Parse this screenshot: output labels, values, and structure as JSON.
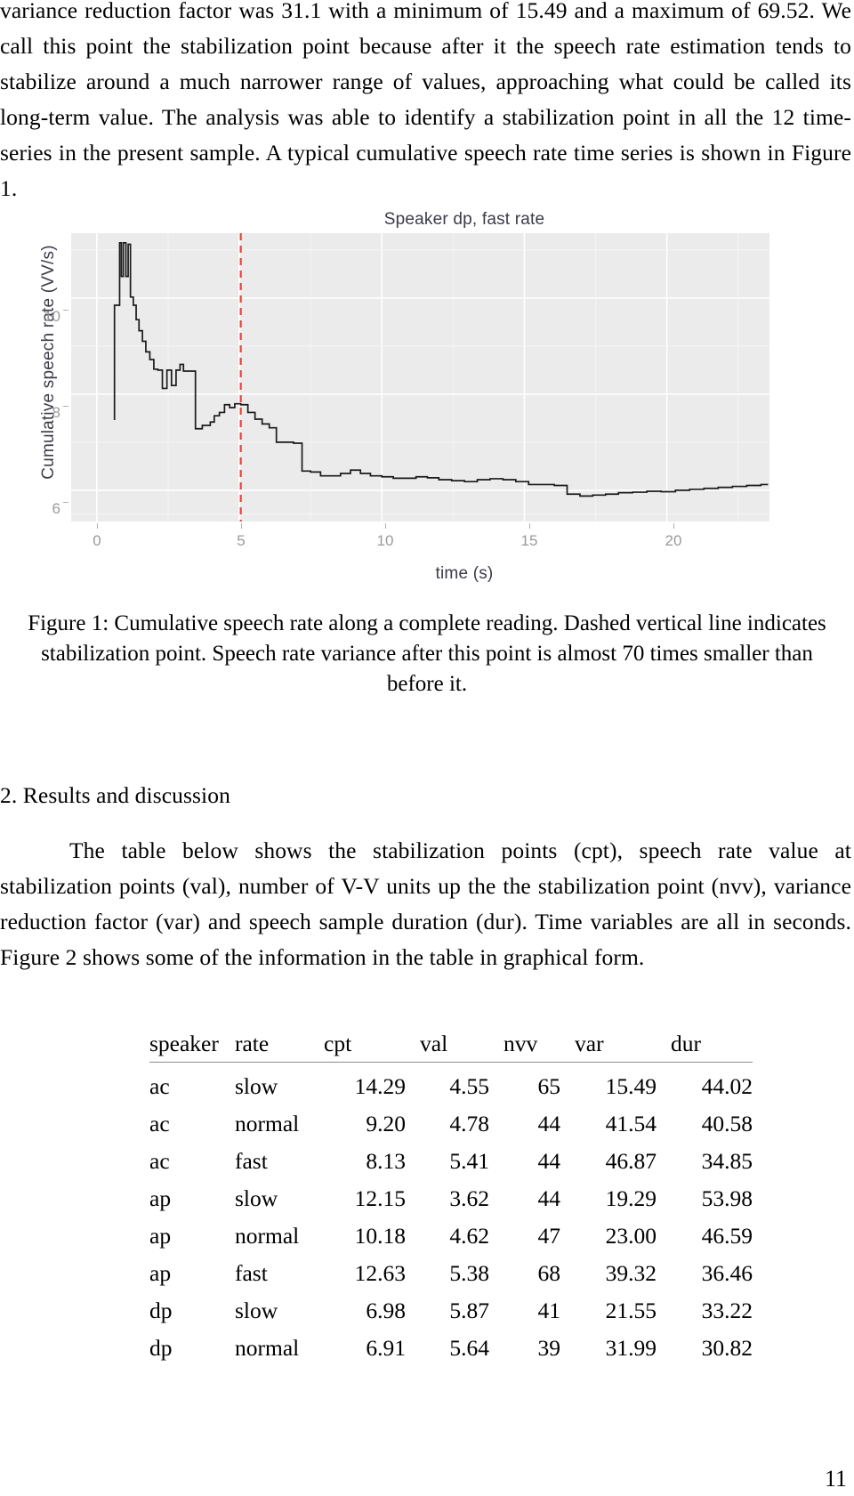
{
  "document": {
    "page_number": "11",
    "paragraph_top": "variance reduction factor was 31.1 with a minimum of 15.49 and a maximum of 69.52. We call this point the stabilization point because after it the speech rate estimation tends to stabilize around a much narrower range of values, approaching what could be called its long-term value. The analysis was able to identify a stabilization point in all the 12 time-series in the present sample. A typical cumulative speech rate time series is shown in Figure 1.",
    "figure_caption": "Figure 1: Cumulative speech rate along a complete reading. Dashed vertical line indicates stabilization point. Speech rate variance after this point is almost 70 times smaller than before it.",
    "section_heading": "2. Results and discussion",
    "paragraph_results": "The table below shows the stabilization points (cpt), speech rate value at stabilization points (val), number of V-V units up the the stabilization point (nvv), variance reduction factor (var) and speech sample duration (dur). Time variables are all in seconds. Figure 2 shows some of the information in the table in graphical form."
  },
  "table": {
    "headers": [
      "speaker",
      "rate",
      "cpt",
      "val",
      "nvv",
      "var",
      "dur"
    ],
    "rows": [
      [
        "ac",
        "slow",
        "14.29",
        "4.55",
        "65",
        "15.49",
        "44.02"
      ],
      [
        "ac",
        "normal",
        "9.20",
        "4.78",
        "44",
        "41.54",
        "40.58"
      ],
      [
        "ac",
        "fast",
        "8.13",
        "5.41",
        "44",
        "46.87",
        "34.85"
      ],
      [
        "ap",
        "slow",
        "12.15",
        "3.62",
        "44",
        "19.29",
        "53.98"
      ],
      [
        "ap",
        "normal",
        "10.18",
        "4.62",
        "47",
        "23.00",
        "46.59"
      ],
      [
        "ap",
        "fast",
        "12.63",
        "5.38",
        "68",
        "39.32",
        "36.46"
      ],
      [
        "dp",
        "slow",
        "6.98",
        "5.87",
        "41",
        "21.55",
        "33.22"
      ],
      [
        "dp",
        "normal",
        "6.91",
        "5.64",
        "39",
        "31.99",
        "30.82"
      ]
    ]
  },
  "chart_data": {
    "type": "line",
    "title": "Speaker dp, fast rate",
    "xlabel": "time (s)",
    "ylabel": "Cumulative speech rate (VV/s)",
    "xticks": [
      "0",
      "5",
      "10",
      "15",
      "20"
    ],
    "yticks": [
      "6",
      "8",
      "10"
    ],
    "xlim": [
      -0.9,
      23.6
    ],
    "ylim": [
      5.35,
      11.35
    ],
    "grid": true,
    "panel_bg": "#ebebeb",
    "grid_color": "#ffffff",
    "line_color": "#1a1a1a",
    "annotation": {
      "type": "vline",
      "label": "stabilization point",
      "x": 5.05,
      "color": "#e8443a",
      "style": "dashed"
    },
    "series": [
      {
        "name": "Cumulative speech rate",
        "step": "hv",
        "x": [
          0.62,
          0.62,
          0.8,
          0.86,
          0.93,
          1.02,
          1.1,
          1.18,
          1.28,
          1.38,
          1.48,
          1.6,
          1.72,
          1.86,
          2.0,
          2.14,
          2.3,
          2.46,
          2.62,
          2.78,
          2.92,
          3.04,
          3.14,
          3.24,
          3.34,
          3.46,
          3.58,
          3.7,
          3.84,
          3.98,
          4.12,
          4.3,
          4.48,
          4.66,
          4.84,
          5.05,
          5.3,
          5.55,
          5.8,
          6.05,
          6.3,
          6.6,
          6.9,
          7.2,
          7.5,
          7.85,
          8.2,
          8.55,
          8.9,
          9.25,
          9.6,
          10.0,
          10.4,
          10.8,
          11.2,
          11.6,
          12.0,
          12.45,
          12.9,
          13.35,
          13.8,
          14.25,
          14.7,
          15.15,
          15.6,
          16.05,
          16.5,
          16.95,
          17.4,
          17.85,
          18.3,
          18.8,
          19.3,
          19.8,
          20.3,
          20.8,
          21.3,
          21.8,
          22.3,
          22.8,
          23.3
        ],
        "y": [
          7.46,
          9.85,
          11.15,
          10.45,
          11.15,
          10.45,
          11.12,
          10.02,
          9.85,
          9.55,
          9.32,
          9.1,
          8.88,
          8.72,
          8.52,
          8.5,
          8.12,
          8.5,
          8.18,
          8.5,
          8.62,
          8.48,
          8.48,
          8.48,
          8.48,
          7.28,
          7.28,
          7.35,
          7.35,
          7.42,
          7.55,
          7.62,
          7.78,
          7.72,
          7.8,
          7.78,
          7.62,
          7.48,
          7.38,
          7.3,
          7.0,
          7.0,
          6.98,
          6.4,
          6.38,
          6.3,
          6.3,
          6.35,
          6.42,
          6.35,
          6.3,
          6.28,
          6.25,
          6.25,
          6.28,
          6.26,
          6.22,
          6.2,
          6.18,
          6.22,
          6.24,
          6.22,
          6.18,
          6.12,
          6.12,
          6.1,
          5.92,
          5.88,
          5.9,
          5.92,
          5.95,
          5.96,
          5.98,
          5.97,
          6.0,
          6.02,
          6.04,
          6.06,
          6.08,
          6.1,
          6.12
        ]
      }
    ]
  }
}
